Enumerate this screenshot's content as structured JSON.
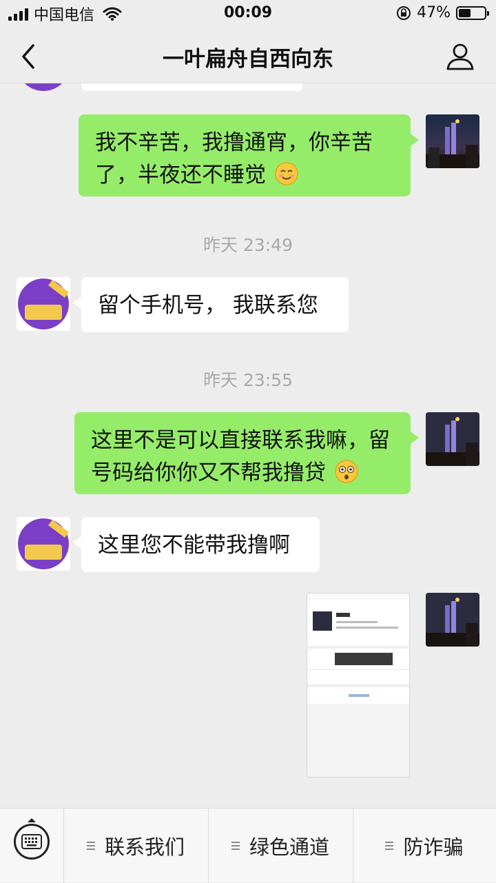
{
  "status_bar": {
    "carrier": "中国电信",
    "time": "00:09",
    "battery_percent": "47%",
    "battery_level": 0.47
  },
  "nav": {
    "title": "一叶扁舟自西向东",
    "back_icon": "chevron-left-icon",
    "profile_icon": "user-icon"
  },
  "messages": [
    {
      "side": "right",
      "text": "我不辛苦，我撸通宵，你辛苦了，半夜还不睡觉",
      "emoji": "smile-blush-emoji"
    },
    {
      "timestamp": "昨天 23:49"
    },
    {
      "side": "left",
      "text": "留个手机号， 我联系您"
    },
    {
      "timestamp": "昨天 23:55"
    },
    {
      "side": "right",
      "text": "这里不是可以直接联系我嘛，留号码给你你又不帮我撸贷",
      "emoji": "dizzy-face-emoji"
    },
    {
      "side": "left",
      "text": "这里您不能带我撸啊"
    },
    {
      "side": "right",
      "type": "image",
      "image_desc": "screenshot-thumbnail"
    }
  ],
  "bottom_menu": {
    "keyboard_icon": "keyboard-icon",
    "items": [
      {
        "label": "联系我们"
      },
      {
        "label": "绿色通道"
      },
      {
        "label": "防诈骗"
      }
    ]
  },
  "colors": {
    "bubble_green": "#95ec69",
    "bubble_white": "#ffffff",
    "background": "#ededed"
  }
}
